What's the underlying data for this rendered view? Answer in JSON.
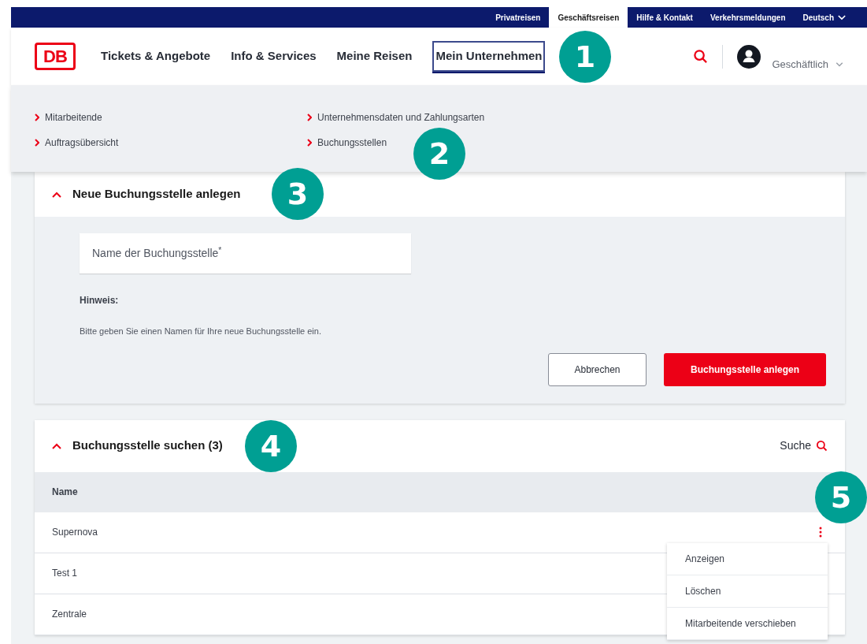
{
  "top_bar": {
    "links": [
      {
        "label": "Privatreisen",
        "selected": false
      },
      {
        "label": "Geschäftsreisen",
        "selected": true
      },
      {
        "label": "Hilfe & Kontakt",
        "selected": false
      },
      {
        "label": "Verkehrsmeldungen",
        "selected": false
      }
    ],
    "language": "Deutsch"
  },
  "header": {
    "logo": "DB",
    "nav": [
      {
        "label": "Tickets & Angebote",
        "selected": false
      },
      {
        "label": "Info & Services",
        "selected": false
      },
      {
        "label": "Meine Reisen",
        "selected": false
      },
      {
        "label": "Mein Unternehmen",
        "selected": true
      }
    ],
    "account": "Geschäftlich"
  },
  "submenu": {
    "columns": [
      {
        "items": [
          "Mitarbeitende",
          "Auftragsübersicht"
        ]
      },
      {
        "items": [
          "Unternehmensdaten und Zahlungsarten",
          "Buchungsstellen"
        ]
      }
    ]
  },
  "create_card": {
    "title": "Neue Buchungsstelle anlegen",
    "expanded": true,
    "field": {
      "label": "Name der Buchungsstelle$^{*}$"
    },
    "hint_title": "Hinweis:",
    "hint_text": "Bitte geben Sie einen Namen für Ihre neue Buchungsstelle ein.",
    "buttons": [
      {
        "label": "Abbrechen",
        "kind": "secondary"
      },
      {
        "label": "Buchungsstelle anlegen",
        "kind": "primary"
      }
    ]
  },
  "search_card": {
    "title": "Buchungsstelle suchen (3)",
    "expanded": true,
    "search_label": "Suche",
    "column": "Name",
    "rows": [
      {
        "name": "Supernova",
        "menu_open": true
      },
      {
        "name": "Test 1",
        "menu_open": false
      },
      {
        "name": "Zentrale",
        "menu_open": false
      }
    ],
    "menu_items": [
      "Anzeigen",
      "Löschen",
      "Mitarbeitende verschieben"
    ]
  },
  "callouts": [
    "1",
    "2",
    "3",
    "4",
    "5"
  ]
}
